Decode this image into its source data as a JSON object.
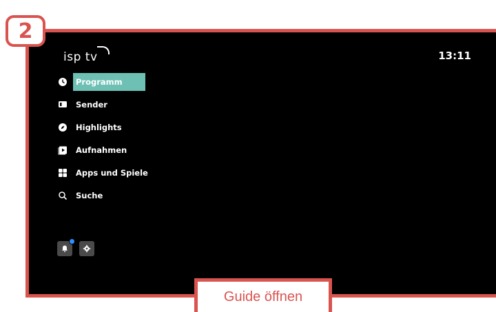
{
  "step": {
    "number": "2"
  },
  "screen": {
    "logo": "isp tv",
    "clock": "13:11"
  },
  "menu": {
    "items": [
      {
        "label": "Programm",
        "icon": "clock-icon",
        "active": true
      },
      {
        "label": "Sender",
        "icon": "tv-icon",
        "active": false
      },
      {
        "label": "Highlights",
        "icon": "compass-icon",
        "active": false
      },
      {
        "label": "Aufnahmen",
        "icon": "play-square-icon",
        "active": false
      },
      {
        "label": "Apps und Spiele",
        "icon": "grid-icon",
        "active": false
      },
      {
        "label": "Suche",
        "icon": "search-icon",
        "active": false
      }
    ]
  },
  "bottom": {
    "notification_icon": "bell-icon",
    "settings_icon": "gear-icon"
  },
  "callout": {
    "label": "Guide öffnen"
  },
  "colors": {
    "accent": "#6ec0b4",
    "frame": "#d9534f",
    "notification_dot": "#2f8fff"
  }
}
